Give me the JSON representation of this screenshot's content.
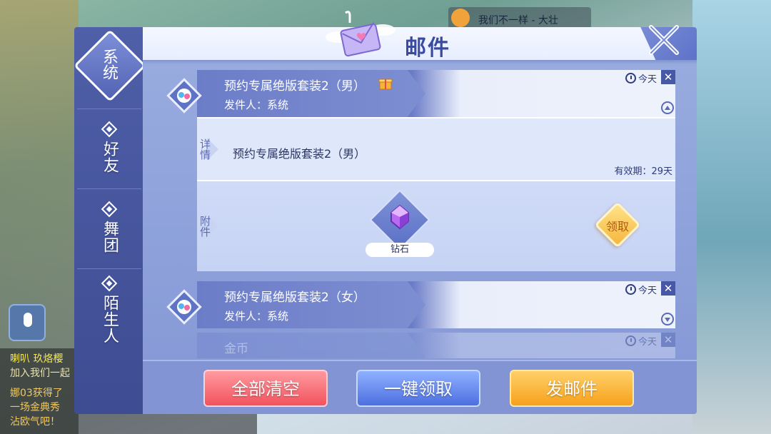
{
  "background": {
    "music_title": "我们不一样 - 大壮",
    "chat_lines": [
      "喇叭 玖烙樱",
      "加入我们一起",
      "娜03获得了",
      "一场金典秀",
      "沾欧气吧！"
    ]
  },
  "panel": {
    "title": "邮件",
    "close_label": "✕"
  },
  "sidebar": {
    "tabs": [
      {
        "label": "系统",
        "active": true
      },
      {
        "label": "好友",
        "active": false
      },
      {
        "label": "舞团",
        "active": false
      },
      {
        "label": "陌生人",
        "active": false
      }
    ]
  },
  "mails": [
    {
      "subject": "预约专属绝版套装2（男）",
      "sender": "发件人：系统",
      "time": "今天",
      "expanded": true,
      "detail_tag": "详情",
      "detail_text": "预约专属绝版套装2（男）",
      "validity": "有效期：29天",
      "attach_tag": "附件",
      "attachment": {
        "name": "钻石",
        "icon": "diamond-icon"
      },
      "claim_label": "领取"
    },
    {
      "subject": "预约专属绝版套装2（女）",
      "sender": "发件人：系统",
      "time": "今天",
      "expanded": false
    },
    {
      "subject": "金币",
      "time": "今天",
      "expanded": false
    }
  ],
  "footer": {
    "clear_all": "全部清空",
    "claim_all": "一键领取",
    "send_mail": "发邮件"
  },
  "colors": {
    "panel_bg": "#8497d6",
    "header_title": "#3a4aa0",
    "btn_red": "#f2535e",
    "btn_blue": "#4d6fe0",
    "btn_orange": "#f7a11b"
  }
}
